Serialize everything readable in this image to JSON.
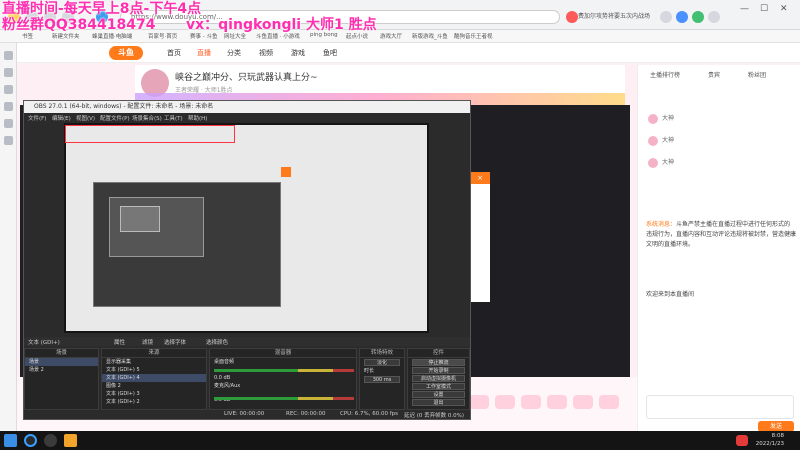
{
  "browser": {
    "address": "https://www.douyu.com/...",
    "news": "费加尔攻势将要五次内战场",
    "window_controls": [
      "—",
      "☐",
      "✕"
    ],
    "bookmarks": [
      "书签",
      "新建文件夹",
      "蜂巢直播·电脑端",
      "百家号·首页",
      "赛事 - 斗鱼",
      "网址大全",
      "斗鱼直播 · 小游戏",
      "ping bong",
      "起点小说",
      "游戏大厅",
      "新版游戏_斗鱼",
      "酷狗音乐王者视"
    ],
    "icons": [
      "back-icon",
      "forward-icon",
      "refresh-icon",
      "home-icon",
      "star-icon",
      "extension-icon"
    ]
  },
  "site": {
    "logo": "斗鱼",
    "nav": [
      "首页",
      "直播",
      "分类",
      "视频",
      "游戏",
      "鱼吧"
    ],
    "room_title": "峡谷之巅冲分、只玩武器认真上分~",
    "room_meta": "王者荣耀 · 大师1胜点",
    "chat_tabs": [
      "主播排行榜",
      "贵宾",
      "粉丝团"
    ],
    "ranks": [
      "大神",
      "大神",
      "大神"
    ],
    "chat_message_name": "系统消息：",
    "chat_message": "斗鱼严禁主播在直播过程中进行任何形式的违规行为，直播内容和互动评论违规将被封禁，营造健康文明的直播环境。",
    "chat_welcome": "欢迎来到本直播间",
    "send": "发送"
  },
  "obs": {
    "title": "OBS 27.0.1 (64-bit, windows) - 配置文件: 未命名 - 场景: 未命名",
    "menu": [
      "文件(F)",
      "编辑(E)",
      "视图(V)",
      "配置文件(P)",
      "场景集合(S)",
      "工具(T)",
      "帮助(H)"
    ],
    "source_bar": [
      "文本 (GDI+)",
      "属性",
      "滤镜",
      "选择字体",
      "选择颜色"
    ],
    "docks": [
      "场景",
      "来源",
      "混音器",
      "转场特效",
      "控件"
    ],
    "scenes": [
      "场景",
      "场景 2"
    ],
    "sources": [
      "显示器采集",
      "文本 (GDI+) 5",
      "文本 (GDI+) 4",
      "图像 2",
      "文本 (GDI+) 3",
      "文本 (GDI+) 2"
    ],
    "mixer": [
      "桌面音频",
      "0.0 dB",
      "麦克风/Aux",
      "0.0 dB"
    ],
    "transition": [
      "淡化",
      "时长",
      "300 ms"
    ],
    "controls": [
      "停止推流",
      "开始录制",
      "启动虚拟摄像机",
      "工作室模式",
      "设置",
      "退出"
    ],
    "status": [
      "LIVE: 00:00:00",
      "REC: 00:00:00",
      "CPU: 6.7%, 60.00 fps",
      "延迟 (0 丢弃帧数 0.0%)"
    ]
  },
  "overlay": {
    "line1": "直播时间-每天早上8点-下午4点",
    "line2": "粉丝群QQ384418474",
    "line3": "vx：qingkongli",
    "line4": "大师1 胜点"
  },
  "taskbar": {
    "time": "8:08",
    "date": "2022/1/23",
    "icons": [
      "windows-start-icon",
      "search-icon",
      "obs-icon",
      "browser-icon",
      "tray-icon"
    ]
  }
}
